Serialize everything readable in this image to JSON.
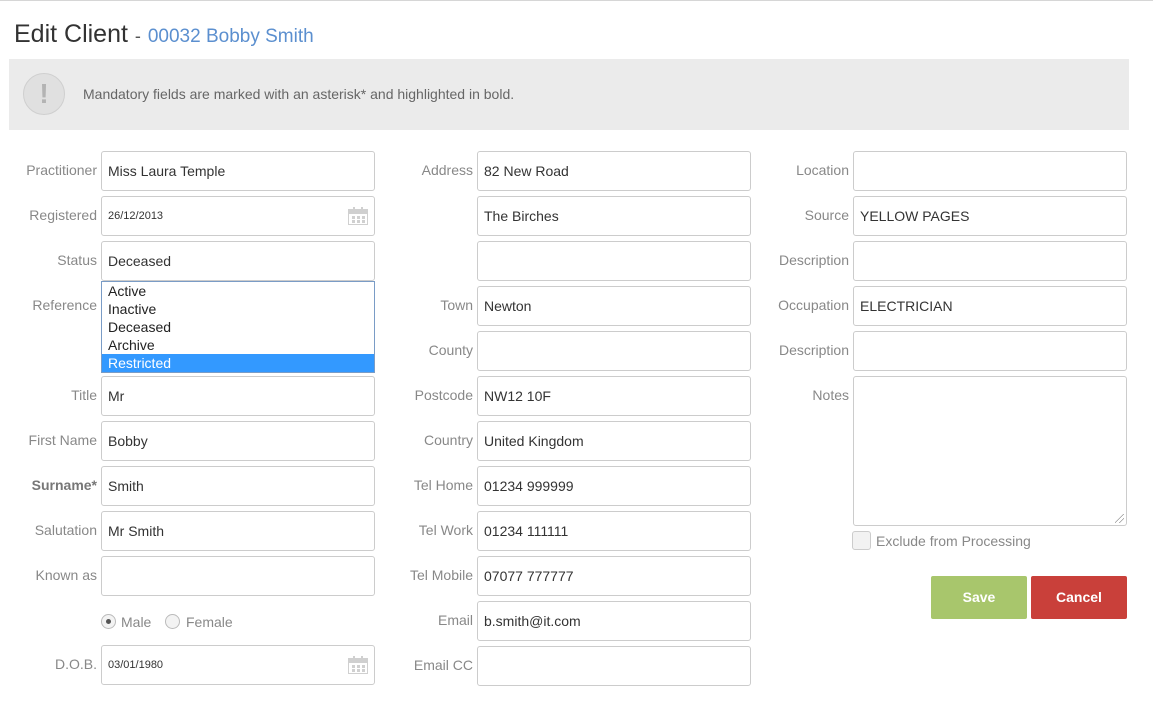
{
  "header": {
    "title": "Edit Client",
    "separator": "-",
    "client_ref": "00032 Bobby Smith"
  },
  "notice": {
    "icon": "!",
    "message": "Mandatory fields are marked with an asterisk* and highlighted in bold."
  },
  "col1": {
    "practitioner": {
      "label": "Practitioner",
      "value": "Miss Laura Temple"
    },
    "registered": {
      "label": "Registered",
      "value": "26/12/2013"
    },
    "status": {
      "label": "Status",
      "value": "Deceased",
      "options": [
        "Active",
        "Inactive",
        "Deceased",
        "Archive",
        "Restricted"
      ],
      "highlighted": "Restricted"
    },
    "reference": {
      "label": "Reference"
    },
    "title": {
      "label": "Title",
      "value": "Mr"
    },
    "first_name": {
      "label": "First Name",
      "value": "Bobby"
    },
    "surname": {
      "label": "Surname*",
      "value": "Smith"
    },
    "salutation": {
      "label": "Salutation",
      "value": "Mr Smith"
    },
    "known_as": {
      "label": "Known as",
      "value": ""
    },
    "gender": {
      "male": "Male",
      "female": "Female",
      "selected": "Male"
    },
    "dob": {
      "label": "D.O.B.",
      "value": "03/01/1980"
    }
  },
  "col2": {
    "address": {
      "label": "Address",
      "line1": "82 New Road",
      "line2": "The Birches",
      "line3": ""
    },
    "town": {
      "label": "Town",
      "value": "Newton"
    },
    "county": {
      "label": "County",
      "value": ""
    },
    "postcode": {
      "label": "Postcode",
      "value": "NW12 10F"
    },
    "country": {
      "label": "Country",
      "value": "United Kingdom"
    },
    "tel_home": {
      "label": "Tel Home",
      "value": "01234 999999"
    },
    "tel_work": {
      "label": "Tel Work",
      "value": "01234 111111"
    },
    "tel_mobile": {
      "label": "Tel Mobile",
      "value": "07077 777777"
    },
    "email": {
      "label": "Email",
      "value": "b.smith@it.com"
    },
    "email_cc": {
      "label": "Email CC",
      "value": ""
    }
  },
  "col3": {
    "location": {
      "label": "Location",
      "value": ""
    },
    "source": {
      "label": "Source",
      "value": "YELLOW PAGES"
    },
    "source_description": {
      "label": "Description",
      "value": ""
    },
    "occupation": {
      "label": "Occupation",
      "value": "ELECTRICIAN"
    },
    "occupation_description": {
      "label": "Description",
      "value": ""
    },
    "notes": {
      "label": "Notes",
      "value": ""
    },
    "exclude": {
      "label": "Exclude from Processing",
      "checked": false
    }
  },
  "buttons": {
    "save": "Save",
    "cancel": "Cancel"
  },
  "colors": {
    "save": "#a8c66c",
    "cancel": "#c9403a",
    "link": "#5b8fcf",
    "selection": "#3399ff"
  }
}
